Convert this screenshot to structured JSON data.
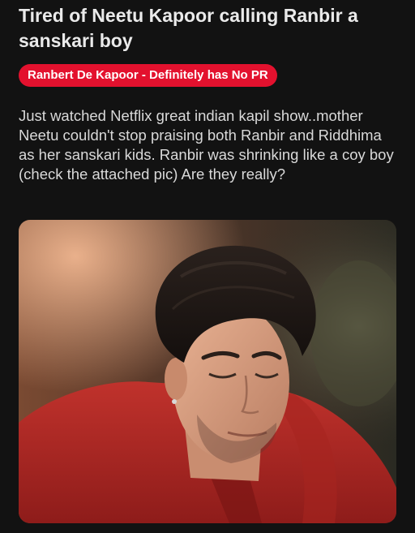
{
  "post": {
    "title": "Tired of Neetu Kapoor calling Ranbir a sanskari boy",
    "flair": "Ranbert De Kapoor - Definitely has No PR",
    "body": "Just watched Netflix great indian kapil show..mother Neetu couldn't stop praising both Ranbir and Riddhima as her sanskari kids. Ranbir was shrinking like a coy boy (check the attached pic) Are they really?"
  },
  "colors": {
    "background": "#121212",
    "flair_background": "#e3112e",
    "text": "#d9d9d9"
  }
}
